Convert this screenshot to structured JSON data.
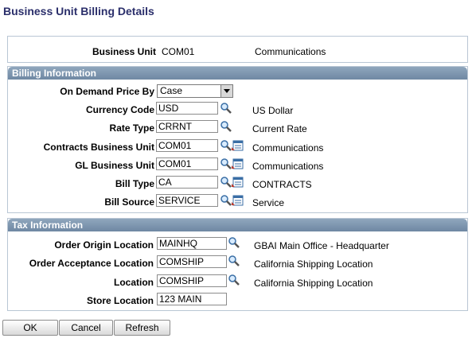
{
  "page_title": "Business Unit Billing Details",
  "business_unit": {
    "label": "Business Unit",
    "code": "COM01",
    "description": "Communications"
  },
  "billing": {
    "header": "Billing Information",
    "on_demand_label": "On Demand Price By",
    "on_demand_value": "Case",
    "currency_label": "Currency Code",
    "currency_value": "USD",
    "currency_desc": "US Dollar",
    "rate_label": "Rate Type",
    "rate_value": "CRRNT",
    "rate_desc": "Current Rate",
    "contracts_label": "Contracts Business Unit",
    "contracts_value": "COM01",
    "contracts_desc": "Communications",
    "gl_label": "GL Business Unit",
    "gl_value": "COM01",
    "gl_desc": "Communications",
    "bill_type_label": "Bill Type",
    "bill_type_value": "CA",
    "bill_type_desc": "CONTRACTS",
    "bill_source_label": "Bill Source",
    "bill_source_value": "SERVICE",
    "bill_source_desc": "Service"
  },
  "tax": {
    "header": "Tax Information",
    "origin_label": "Order Origin Location",
    "origin_value": "MAINHQ",
    "origin_desc": "GBAI Main Office - Headquarter",
    "acceptance_label": "Order Acceptance Location",
    "acceptance_value": "COMSHIP",
    "acceptance_desc": "California Shipping Location",
    "location_label": "Location",
    "location_value": "COMSHIP",
    "location_desc": "California Shipping Location",
    "store_label": "Store Location",
    "store_value": "123 MAIN"
  },
  "buttons": {
    "ok": "OK",
    "cancel": "Cancel",
    "refresh": "Refresh"
  },
  "colors": {
    "title": "#2b2f6b",
    "group_header": "#7b93ad",
    "border": "#b9c6d4"
  }
}
